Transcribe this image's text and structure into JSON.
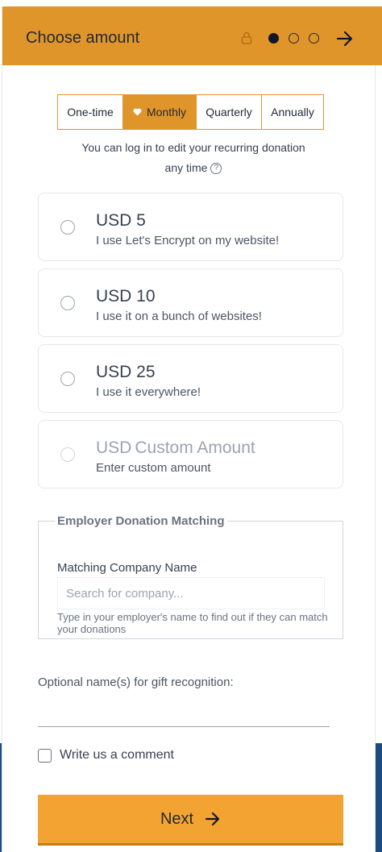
{
  "header": {
    "title": "Choose amount",
    "steps": {
      "current": 1,
      "total": 3
    }
  },
  "frequency": {
    "options": [
      "One-time",
      "Monthly",
      "Quarterly",
      "Annually"
    ],
    "selected": "Monthly"
  },
  "login_note": {
    "line1": "You can log in to edit your recurring donation",
    "line2": "any time",
    "help_glyph": "?"
  },
  "amounts": [
    {
      "amount": "USD 5",
      "description": "I use Let's Encrypt on my website!"
    },
    {
      "amount": "USD 10",
      "description": "I use it on a bunch of websites!"
    },
    {
      "amount": "USD 25",
      "description": "I use it everywhere!"
    }
  ],
  "custom_amount": {
    "currency": "USD",
    "placeholder": "Custom Amount",
    "description": "Enter custom amount"
  },
  "matching": {
    "legend": "Employer Donation Matching",
    "label": "Matching Company Name",
    "placeholder": "Search for company...",
    "help": "Type in your employer's name to find out if they can match your donations"
  },
  "gift": {
    "label": "Optional name(s) for gift recognition:",
    "value": ""
  },
  "comment": {
    "label": "Write us a comment",
    "checked": false
  },
  "next_button": {
    "label": "Next"
  },
  "colors": {
    "accent": "#e0952b",
    "button": "#f3a332",
    "footer_bg": "#1e4b7e"
  }
}
